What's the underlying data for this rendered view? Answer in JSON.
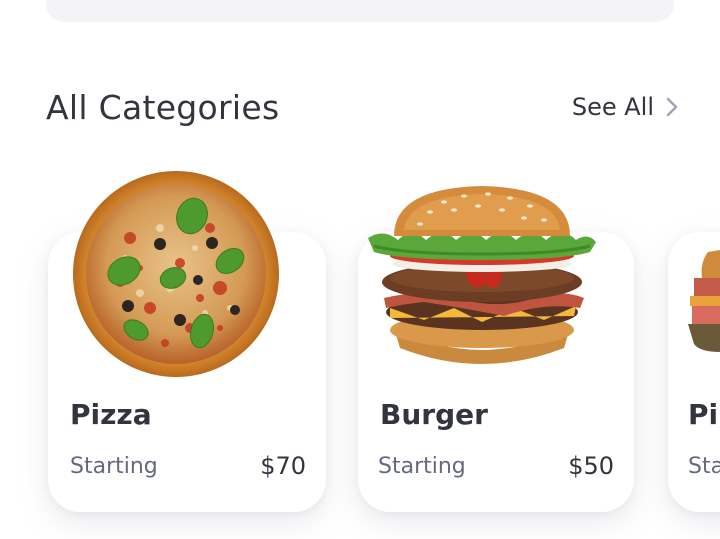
{
  "section": {
    "title": "All Categories",
    "see_all_label": "See All"
  },
  "categories": [
    {
      "name": "Pizza",
      "starting_label": "Starting",
      "price": "$70",
      "image_icon": "pizza-image"
    },
    {
      "name": "Burger",
      "starting_label": "Starting",
      "price": "$50",
      "image_icon": "burger-image"
    },
    {
      "name": "Pi",
      "starting_label": "Sta",
      "price": "",
      "image_icon": "sandwich-image"
    }
  ],
  "colors": {
    "text_dark": "#32343e",
    "text_muted": "#646982",
    "card_bg": "#ffffff"
  }
}
